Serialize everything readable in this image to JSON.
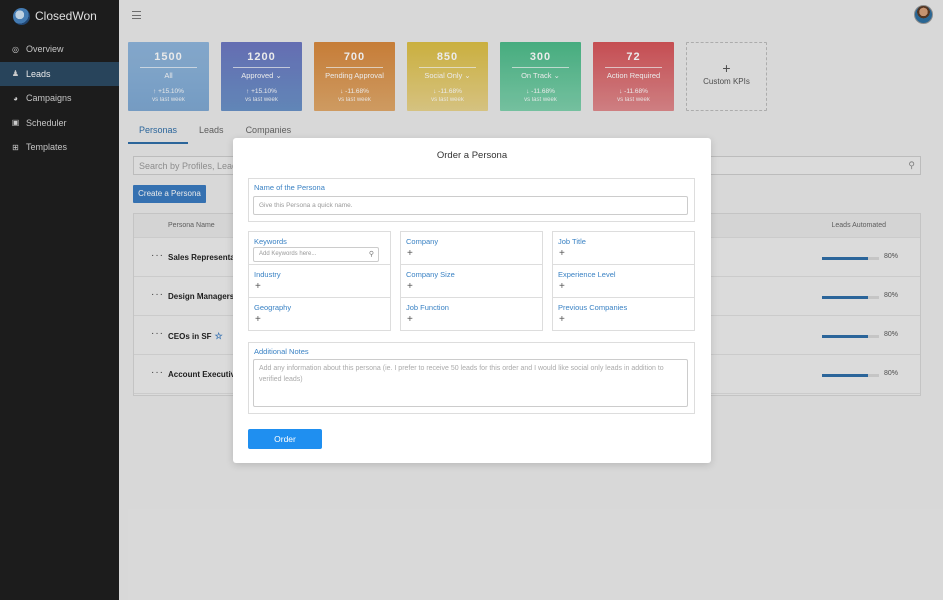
{
  "brand": {
    "name": "ClosedWon"
  },
  "nav": [
    {
      "label": "Overview",
      "icon": "chat-icon",
      "glyph": "◎"
    },
    {
      "label": "Leads",
      "icon": "user-icon",
      "glyph": "♟",
      "active": true
    },
    {
      "label": "Campaigns",
      "icon": "pie-chart-icon",
      "glyph": "◕"
    },
    {
      "label": "Scheduler",
      "icon": "calendar-icon",
      "glyph": "▣"
    },
    {
      "label": "Templates",
      "icon": "template-icon",
      "glyph": "⊞"
    }
  ],
  "kpis": [
    {
      "value": "1500",
      "label": "All",
      "pct": "↑ +15.10%",
      "since": "vs last week"
    },
    {
      "value": "1200",
      "label": "Approved ⌄",
      "pct": "↑ +15.10%",
      "since": "vs last week"
    },
    {
      "value": "700",
      "label": "Pending Approval",
      "pct": "↓ -11.68%",
      "since": "vs last week"
    },
    {
      "value": "850",
      "label": "Social Only ⌄",
      "pct": "↓ -11.68%",
      "since": "vs last week"
    },
    {
      "value": "300",
      "label": "On Track ⌄",
      "pct": "↓ -11.68%",
      "since": "vs last week"
    },
    {
      "value": "72",
      "label": "Action Required",
      "pct": "↓ -11.68%",
      "since": "vs last week"
    }
  ],
  "custom_kpi": {
    "plus": "+",
    "label": "Custom KPIs"
  },
  "tabs": [
    "Personas",
    "Leads",
    "Companies"
  ],
  "search": {
    "placeholder": "Search by Profiles, Lead",
    "icon": "search-icon"
  },
  "create_button": "Create a Persona",
  "table": {
    "col_name": "Persona Name",
    "col_leads": "Leads Automated",
    "rows": [
      {
        "name": "Sales Representati",
        "pct": "80%",
        "fill": 0.8
      },
      {
        "name": "Design Managers",
        "pct": "80%",
        "fill": 0.8
      },
      {
        "name": "CEOs in SF",
        "pct": "80%",
        "fill": 0.8,
        "starred": true
      },
      {
        "name": "Account Executive",
        "pct": "80%",
        "fill": 0.8
      }
    ]
  },
  "modal": {
    "title": "Order a Persona",
    "name_label": "Name of the Persona",
    "name_placeholder": "Give this Persona a quick name.",
    "keywords_label": "Keywords",
    "keywords_placeholder": "Add Keywords here...",
    "industry_label": "Industry",
    "geography_label": "Geography",
    "company_label": "Company",
    "company_size_label": "Company Size",
    "job_function_label": "Job Function",
    "job_title_label": "Job Title",
    "experience_label": "Experience Level",
    "previous_companies_label": "Previous Companies",
    "notes_label": "Additional Notes",
    "notes_placeholder": "Add any information about this persona (ie. I prefer to receive 50 leads for this order and I would like social only leads in addition to verified leads)",
    "order_button": "Order",
    "plus": "+"
  }
}
